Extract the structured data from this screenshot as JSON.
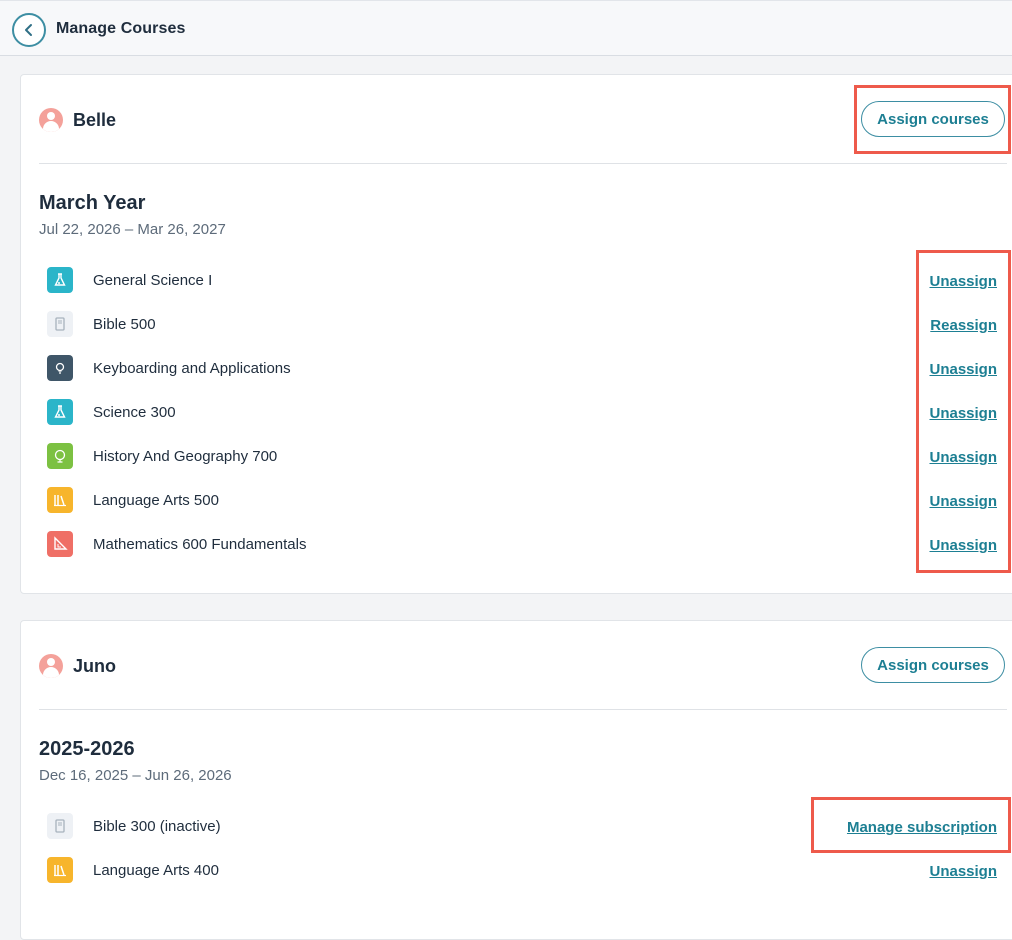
{
  "header": {
    "title": "Manage Courses",
    "back_icon": "chevron-left-icon"
  },
  "colors": {
    "accent": "#1d7f93",
    "highlight": "#ee5a4b",
    "avatar": "#f4a19a",
    "science": "#2bb5c9",
    "bible": "#eef1f5",
    "keyboarding": "#3f5668",
    "history": "#7cc142",
    "language_arts": "#f7b52c",
    "mathematics": "#ef6f66"
  },
  "students": [
    {
      "name": "Belle",
      "assign_label": "Assign courses",
      "year": {
        "title": "March Year",
        "dates": "Jul 22, 2026 – Mar 26, 2027"
      },
      "courses": [
        {
          "name": "General Science I",
          "action": "Unassign",
          "icon": "science-flask-icon"
        },
        {
          "name": "Bible 500",
          "action": "Reassign",
          "icon": "bible-book-icon"
        },
        {
          "name": "Keyboarding and Applications",
          "action": "Unassign",
          "icon": "lightbulb-icon"
        },
        {
          "name": "Science 300",
          "action": "Unassign",
          "icon": "science-flask-icon"
        },
        {
          "name": "History And Geography 700",
          "action": "Unassign",
          "icon": "globe-icon"
        },
        {
          "name": "Language Arts 500",
          "action": "Unassign",
          "icon": "books-icon"
        },
        {
          "name": "Mathematics 600 Fundamentals",
          "action": "Unassign",
          "icon": "ruler-triangle-icon"
        }
      ]
    },
    {
      "name": "Juno",
      "assign_label": "Assign courses",
      "year": {
        "title": "2025-2026",
        "dates": "Dec 16, 2025 – Jun 26, 2026"
      },
      "courses": [
        {
          "name": "Bible 300 (inactive)",
          "action": "Manage subscription",
          "icon": "bible-book-icon"
        },
        {
          "name": "Language Arts 400",
          "action": "Unassign",
          "icon": "books-icon"
        }
      ]
    }
  ]
}
